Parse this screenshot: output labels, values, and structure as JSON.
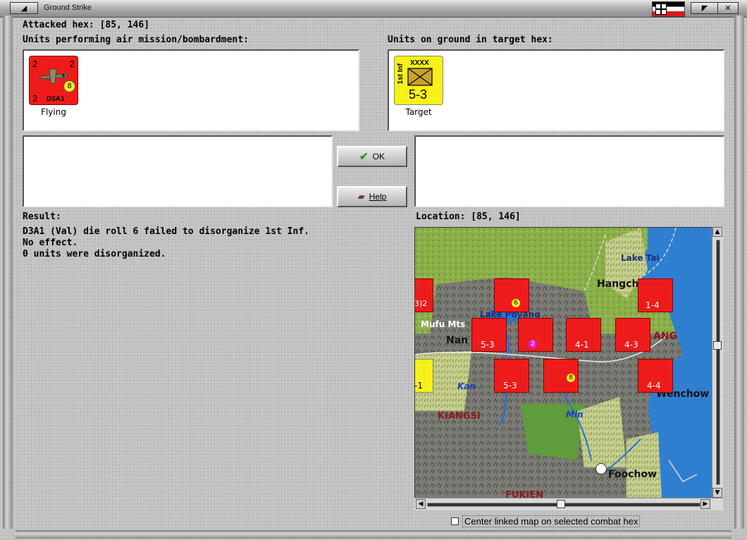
{
  "window": {
    "title": "Ground Strike"
  },
  "header": {
    "attacked_hex_label": "Attacked hex:",
    "attacked_hex_value": "[85, 146]"
  },
  "air_units": {
    "heading": "Units performing air mission/bombardment:",
    "items": [
      {
        "name": "D3A1",
        "tl": "2",
        "tr": "2",
        "bl": "2",
        "value": "8",
        "status": "Flying"
      }
    ]
  },
  "ground_units": {
    "heading": "Units on ground in target hex:",
    "items": [
      {
        "name": "1st Inf",
        "size": "XXXX",
        "strength": "5-3",
        "status": "Target"
      }
    ]
  },
  "buttons": {
    "ok": "OK",
    "help": "Help"
  },
  "result": {
    "heading": "Result:",
    "lines": [
      "D3A1 (Val) die roll 6 failed to disorganize 1st Inf.",
      "No effect.",
      "0 units were disorganized."
    ]
  },
  "location": {
    "label": "Location:",
    "value": "[85, 146]"
  },
  "map": {
    "labels": [
      "Lake Tai",
      "Hangch",
      "Lake Poyang",
      "Mufu Mts",
      "Nan",
      "ANG",
      "Kan",
      "KIANGSI",
      "Min",
      "Wenchow",
      "Foochow",
      "FUKIEN"
    ],
    "counter_values": [
      "5-3",
      "4-1",
      "4-3",
      "1-4",
      "5-3",
      "4-4",
      "6",
      "8",
      "2",
      "-1",
      "3)2"
    ]
  },
  "footer": {
    "center_map_label": "Center linked map on selected combat hex"
  },
  "colors": {
    "allied_counter": "#ee1b1b",
    "target_counter": "#f7f01a",
    "sea": "#2f7fd1"
  }
}
